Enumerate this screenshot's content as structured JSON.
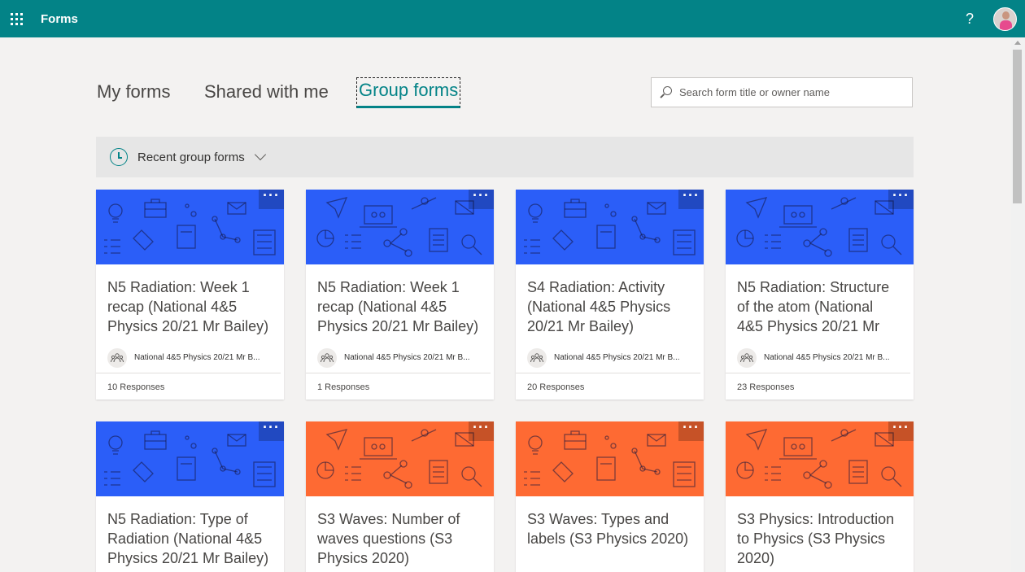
{
  "header": {
    "app_title": "Forms",
    "help_label": "?"
  },
  "tabs": [
    {
      "label": "My forms"
    },
    {
      "label": "Shared with me"
    },
    {
      "label": "Group forms"
    }
  ],
  "search": {
    "placeholder": "Search form title or owner name"
  },
  "filter": {
    "label": "Recent group forms"
  },
  "colors": {
    "topbar": "#038387",
    "blue_banner": "#2b5ef8",
    "orange_banner": "#fe6a33"
  },
  "cards": [
    {
      "title": "N5 Radiation: Week 1 recap (National 4&5 Physics 20/21 Mr Bailey)",
      "group": "National 4&5 Physics 20/21 Mr B...",
      "responses": "10 Responses",
      "banner": "blue",
      "more": "···"
    },
    {
      "title": "N5 Radiation: Week 1 recap (National 4&5 Physics 20/21 Mr Bailey)",
      "group": "National 4&5 Physics 20/21 Mr B...",
      "responses": "1 Responses",
      "banner": "blue",
      "more": "···"
    },
    {
      "title": "S4 Radiation: Activity (National 4&5 Physics 20/21 Mr Bailey)",
      "group": "National 4&5 Physics 20/21 Mr B...",
      "responses": "20 Responses",
      "banner": "blue",
      "more": "···"
    },
    {
      "title": "N5 Radiation: Structure of the atom (National 4&5 Physics 20/21 Mr",
      "group": "National 4&5 Physics 20/21 Mr B...",
      "responses": "23 Responses",
      "banner": "blue",
      "more": "···"
    },
    {
      "title": "N5 Radiation: Type of Radiation (National 4&5 Physics 20/21 Mr Bailey)",
      "banner": "blue",
      "more": "···"
    },
    {
      "title": "S3 Waves: Number of waves questions (S3 Physics 2020)",
      "banner": "orange",
      "more": "···"
    },
    {
      "title": "S3 Waves: Types and labels (S3 Physics 2020)",
      "banner": "orange",
      "more": "···"
    },
    {
      "title": "S3 Physics: Introduction to Physics (S3 Physics 2020)",
      "banner": "orange",
      "more": "···"
    }
  ]
}
